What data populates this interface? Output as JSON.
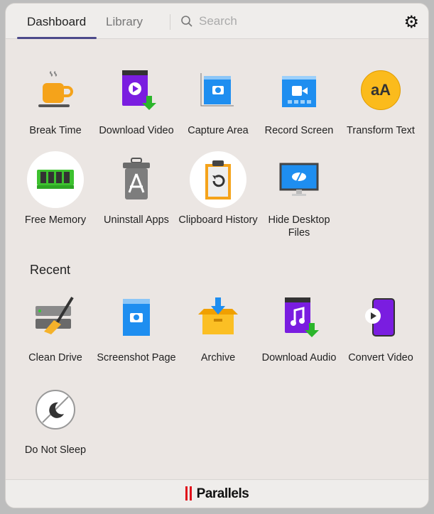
{
  "header": {
    "tabs": [
      {
        "label": "Dashboard",
        "active": true
      },
      {
        "label": "Library",
        "active": false
      }
    ],
    "search_placeholder": "Search",
    "settings_icon": "gear-icon"
  },
  "dashboard": {
    "items": [
      {
        "label": "Break Time",
        "icon": "coffee-cup-icon"
      },
      {
        "label": "Download Video",
        "icon": "download-video-icon"
      },
      {
        "label": "Capture Area",
        "icon": "capture-area-icon"
      },
      {
        "label": "Record Screen",
        "icon": "record-screen-icon"
      },
      {
        "label": "Transform Text",
        "icon": "transform-text-icon"
      },
      {
        "label": "Free Memory",
        "icon": "memory-chip-icon"
      },
      {
        "label": "Uninstall Apps",
        "icon": "trash-app-icon"
      },
      {
        "label": "Clipboard History",
        "icon": "clipboard-history-icon"
      },
      {
        "label": "Hide Desktop Files",
        "icon": "hide-desktop-icon"
      }
    ]
  },
  "recent": {
    "title": "Recent",
    "items": [
      {
        "label": "Clean Drive",
        "icon": "clean-drive-icon"
      },
      {
        "label": "Screenshot Page",
        "icon": "screenshot-page-icon"
      },
      {
        "label": "Archive",
        "icon": "archive-box-icon"
      },
      {
        "label": "Download Audio",
        "icon": "download-audio-icon"
      },
      {
        "label": "Convert Video",
        "icon": "convert-video-icon"
      },
      {
        "label": "Do Not Sleep",
        "icon": "do-not-sleep-icon"
      }
    ]
  },
  "footer": {
    "brand": "Parallels",
    "brand_color": "#e0101a"
  },
  "colors": {
    "tab_underline": "#4c4a8a",
    "background": "#ebe6e3"
  }
}
